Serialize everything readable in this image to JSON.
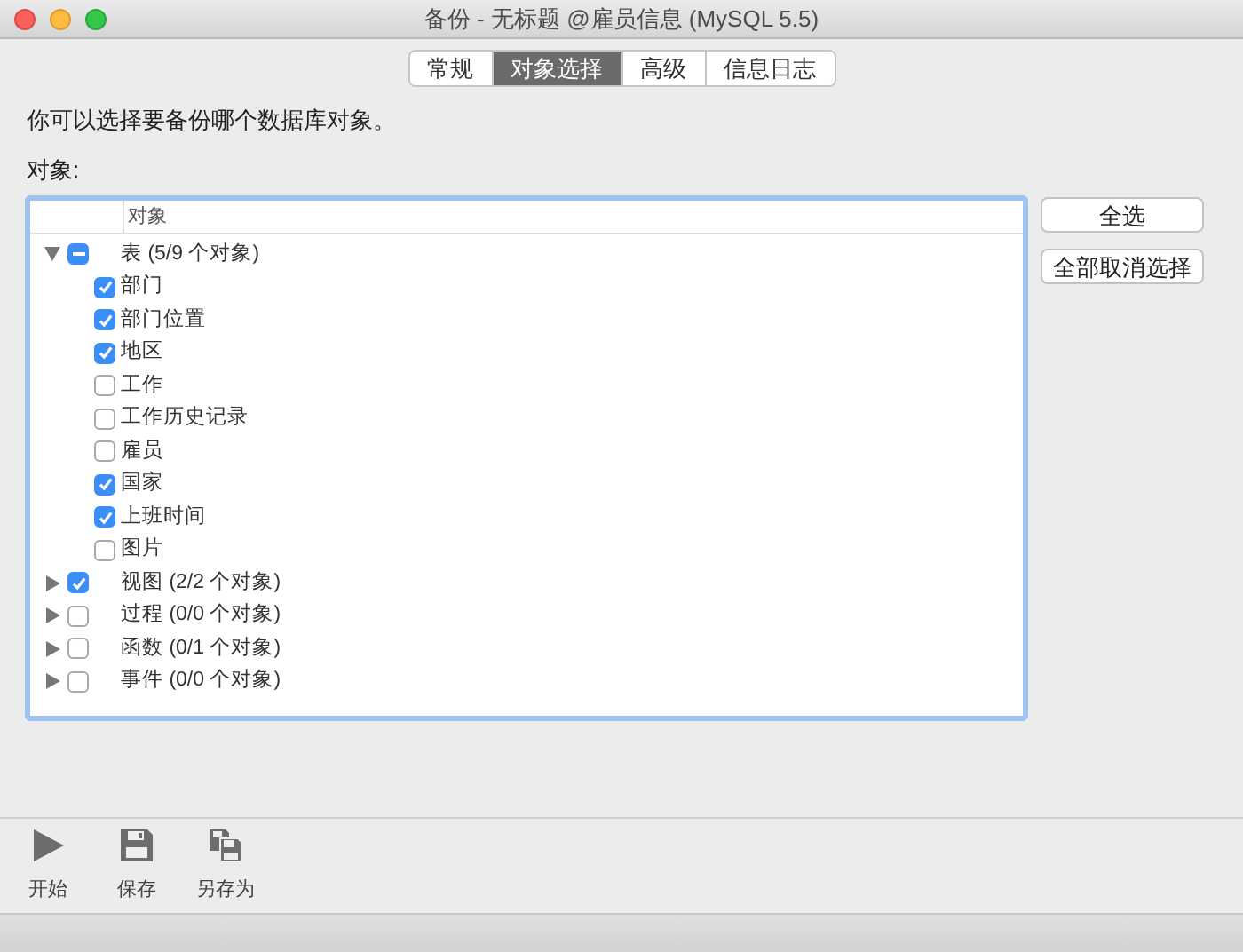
{
  "window": {
    "title": "备份 - 无标题 @雇员信息 (MySQL 5.5)"
  },
  "tabs": [
    {
      "label": "常规",
      "selected": false
    },
    {
      "label": "对象选择",
      "selected": true
    },
    {
      "label": "高级",
      "selected": false
    },
    {
      "label": "信息日志",
      "selected": false
    }
  ],
  "instruction": "你可以选择要备份哪个数据库对象。",
  "objects_label": "对象:",
  "tree": {
    "column": "对象",
    "items": [
      {
        "label": "表 (5/9 个对象)",
        "expanded": true,
        "checked": true,
        "mixed": true,
        "children": [
          {
            "label": "部门",
            "checked": true
          },
          {
            "label": "部门位置",
            "checked": true
          },
          {
            "label": "地区",
            "checked": true
          },
          {
            "label": "工作",
            "checked": false
          },
          {
            "label": "工作历史记录",
            "checked": false
          },
          {
            "label": "雇员",
            "checked": false
          },
          {
            "label": "国家",
            "checked": true
          },
          {
            "label": "上班时间",
            "checked": true
          },
          {
            "label": "图片",
            "checked": false
          }
        ]
      },
      {
        "label": "视图 (2/2 个对象)",
        "expanded": false,
        "checked": true
      },
      {
        "label": "过程 (0/0 个对象)",
        "expanded": false,
        "checked": false
      },
      {
        "label": "函数 (0/1 个对象)",
        "expanded": false,
        "checked": false
      },
      {
        "label": "事件 (0/0 个对象)",
        "expanded": false,
        "checked": false
      }
    ]
  },
  "side_buttons": [
    "全选",
    "全部取消选择"
  ],
  "toolbar": [
    {
      "kind": "play",
      "label": "开始"
    },
    {
      "kind": "save",
      "label": "保存"
    },
    {
      "kind": "saveas",
      "label": "另存为"
    }
  ]
}
